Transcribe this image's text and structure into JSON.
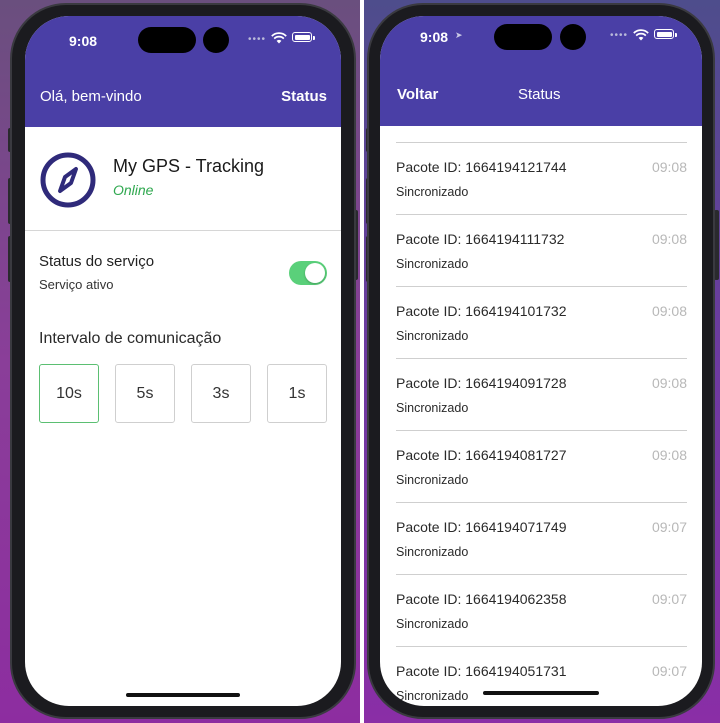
{
  "colors": {
    "navbar": "#4a3fa6",
    "online": "#2fa84f",
    "toggle_on": "#5ad07a",
    "selected_border": "#5bbf72"
  },
  "left_phone": {
    "status_bar": {
      "time": "9:08"
    },
    "navbar": {
      "greeting": "Olá, bem-vindo",
      "status_link": "Status"
    },
    "app": {
      "name": "My GPS - Tracking",
      "status": "Online",
      "icon": "compass-icon"
    },
    "service": {
      "title": "Status do serviço",
      "subtitle": "Serviço ativo",
      "enabled": true
    },
    "interval": {
      "title": "Intervalo de comunicação",
      "options": [
        "10s",
        "5s",
        "3s",
        "1s"
      ],
      "selected": "10s"
    }
  },
  "right_phone": {
    "status_bar": {
      "time": "9:08"
    },
    "navbar": {
      "back": "Voltar",
      "title": "Status"
    },
    "packets": [
      {
        "id": "Pacote ID: 1664194121744",
        "time": "09:08",
        "status": "Sincronizado"
      },
      {
        "id": "Pacote ID: 1664194111732",
        "time": "09:08",
        "status": "Sincronizado"
      },
      {
        "id": "Pacote ID: 1664194101732",
        "time": "09:08",
        "status": "Sincronizado"
      },
      {
        "id": "Pacote ID: 1664194091728",
        "time": "09:08",
        "status": "Sincronizado"
      },
      {
        "id": "Pacote ID: 1664194081727",
        "time": "09:08",
        "status": "Sincronizado"
      },
      {
        "id": "Pacote ID: 1664194071749",
        "time": "09:07",
        "status": "Sincronizado"
      },
      {
        "id": "Pacote ID: 1664194062358",
        "time": "09:07",
        "status": "Sincronizado"
      },
      {
        "id": "Pacote ID: 1664194051731",
        "time": "09:07",
        "status": "Sincronizado"
      }
    ]
  }
}
